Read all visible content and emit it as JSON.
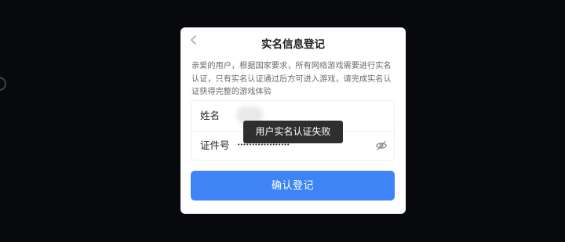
{
  "dialog": {
    "title": "实名信息登记",
    "notice": "亲爱的用户，根据国家要求，所有网络游戏需要进行实名认证，只有实名认证通过后方可进入游戏，请完成实名认证获得完整的游戏体验",
    "back_icon": "chevron-left-icon",
    "form": {
      "name_label": "姓名",
      "name_value": "",
      "id_label": "证件号",
      "id_value": "••••••••••••••••••",
      "visibility_icon": "eye-off-icon"
    },
    "confirm_label": "确认登记"
  },
  "toast": {
    "message": "用户实名认证失败"
  },
  "colors": {
    "background": "#08090d",
    "primary": "#3e84f6",
    "toast_bg": "#262626"
  }
}
